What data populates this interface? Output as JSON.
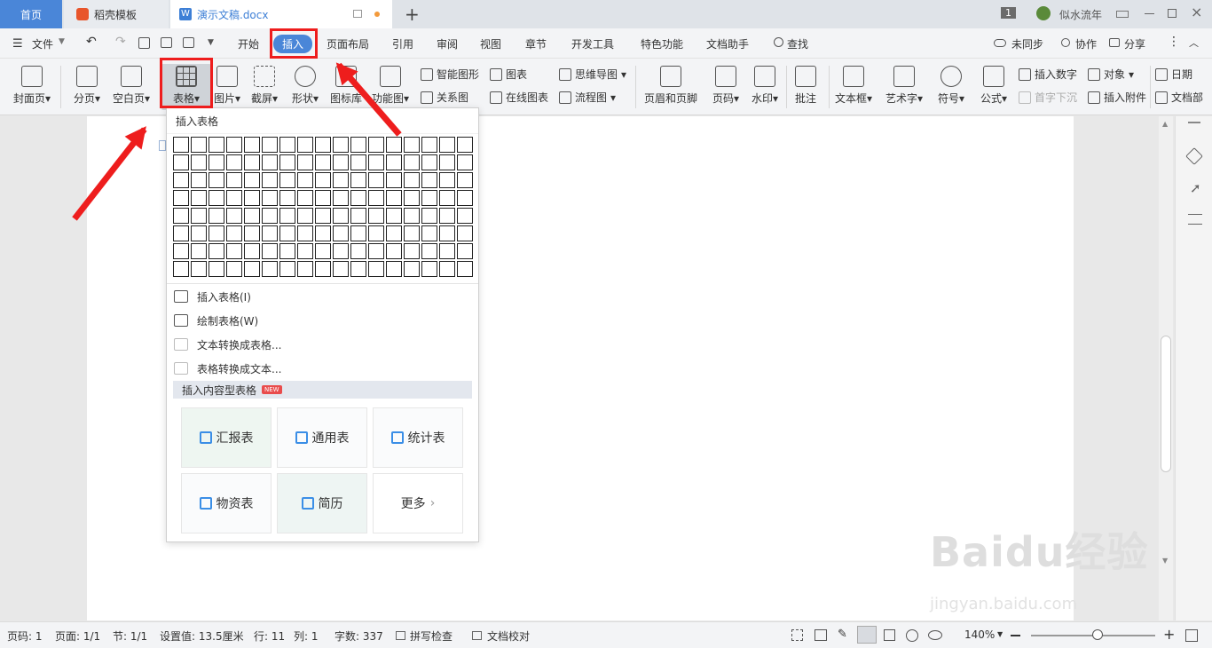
{
  "tabs": {
    "home": "首页",
    "template": "稻壳模板",
    "doc": "演示文稿.docx",
    "page_badge": "1",
    "user": "似水流年"
  },
  "menu": {
    "file": "文件",
    "start": "开始",
    "insert": "插入",
    "layout": "页面布局",
    "ref": "引用",
    "review": "审阅",
    "view": "视图",
    "chapter": "章节",
    "dev": "开发工具",
    "special": "特色功能",
    "assist": "文档助手",
    "find": "查找",
    "sync": "未同步",
    "collab": "协作",
    "share": "分享"
  },
  "ribbon": {
    "cover": "封面页",
    "pagebreak": "分页",
    "blank": "空白页",
    "table": "表格",
    "picture": "图片",
    "screenshot": "截屏",
    "shape": "形状",
    "iconlib": "图标库",
    "funcmap": "功能图",
    "smartshape": "智能图形",
    "chart": "图表",
    "mindmap": "思维导图",
    "relation": "关系图",
    "onlinechart": "在线图表",
    "flowchart": "流程图",
    "headerfooter": "页眉和页脚",
    "pagenum": "页码",
    "watermark": "水印",
    "comment": "批注",
    "textbox": "文本框",
    "wordart": "艺术字",
    "symbol": "符号",
    "formula": "公式",
    "insertnum": "插入数字",
    "object": "对象",
    "date": "日期",
    "dropcap": "首字下沉",
    "attach": "插入附件",
    "docpart": "文档部"
  },
  "dropdown": {
    "title": "插入表格",
    "insert_table": "插入表格(I)",
    "draw_table": "绘制表格(W)",
    "text_to_table": "文本转换成表格...",
    "table_to_text": "表格转换成文本...",
    "content_tables": "插入内容型表格",
    "new_badge": "NEW",
    "cards": [
      "汇报表",
      "通用表",
      "统计表",
      "物资表",
      "简历",
      "更多"
    ]
  },
  "status": {
    "page": "页码: 1",
    "pages": "页面: 1/1",
    "section": "节: 1/1",
    "setting": "设置值: 13.5厘米",
    "row": "行: 11",
    "col": "列: 1",
    "words": "字数: 337",
    "spell": "拼写检查",
    "proof": "文档校对",
    "zoom": "140%"
  },
  "watermark": {
    "main": "Baidu经验",
    "sub": "jingyan.baidu.com"
  }
}
